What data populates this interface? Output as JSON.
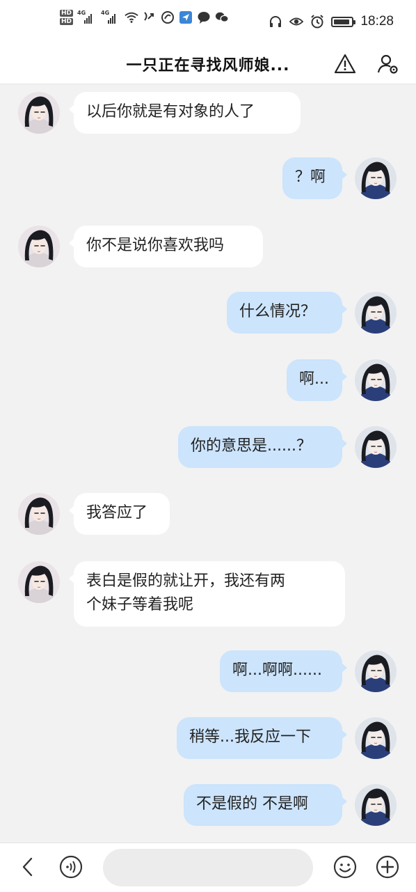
{
  "status_bar": {
    "hd1": "HD",
    "hd2": "HD",
    "net1": "4G",
    "net2": "4G",
    "time": "18:28",
    "icons": [
      "wifi-icon",
      "wifi-calling-icon",
      "app-sync-icon",
      "app-notify-icon",
      "chat-bubble-icon",
      "wechat-icon",
      "headset-icon",
      "eye-icon",
      "alarm-icon",
      "battery-icon"
    ]
  },
  "header": {
    "title": "一只正在寻找风师娘..."
  },
  "messages": [
    {
      "side": "in",
      "text": "以后你就是有对象的人了"
    },
    {
      "side": "out",
      "text": "？啊"
    },
    {
      "side": "in",
      "text": "你不是说你喜欢我吗"
    },
    {
      "side": "out",
      "text": "什么情况？"
    },
    {
      "side": "out",
      "text": "啊..."
    },
    {
      "side": "out",
      "text": "你的意思是......？"
    },
    {
      "side": "in",
      "text": "我答应了"
    },
    {
      "side": "in",
      "text": "表白是假的就让开，我还有两\n个妹子等着我呢"
    },
    {
      "side": "out",
      "text": "啊...啊啊......"
    },
    {
      "side": "out",
      "text": "稍等...我反应一下"
    },
    {
      "side": "out",
      "text": "不是假的 不是啊"
    }
  ],
  "input": {
    "value": "",
    "placeholder": ""
  },
  "colors": {
    "chat_bg": "#f2f2f2",
    "incoming_bubble": "#ffffff",
    "outgoing_bubble": "#cce4fc",
    "bar_bg": "#ffffff"
  }
}
